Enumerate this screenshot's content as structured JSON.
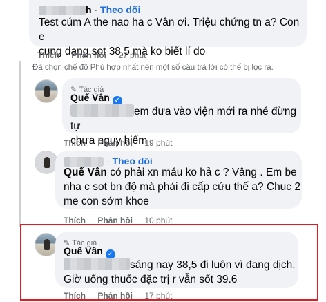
{
  "comment1": {
    "name_suffix": "h",
    "separator": "·",
    "follow": "Theo dõi",
    "text_line1": "Test cúm A the nao ha c Vân ơi. Triệu chứng tn a? Con e",
    "text_line2": "cung dang sot 38,5 mà ko biết lí do",
    "like": "Thích",
    "reply": "Phản hồi",
    "time": "27 phút"
  },
  "filter_notice": "Đã chọn chế độ Phù hợp nhất nên một số câu trả lời có thể bị lọc ra.",
  "reply1": {
    "author_tag": "Tác giả",
    "author": "Quế Vân",
    "text_line1": "em đưa vào viện mới ra nhé đừng tự",
    "text_line2": "chưa nguy hiểm",
    "like": "Thích",
    "reply": "Phản hồi",
    "time": "19 phút"
  },
  "reply2": {
    "separator": "·",
    "follow": "Theo dõi",
    "mention": "Quế Vân",
    "text_line1": " có phải xn máu ko hả c ? Vâng . Em be",
    "text_line2": "nha c sot bn độ mà phải đi cấp cứu thế a? Chuc 2",
    "text_line3": "me con sớm khoe",
    "like": "Thích",
    "reply": "Phản hồi",
    "time": "10 phút"
  },
  "reply3": {
    "author_tag": "Tác giả",
    "author": "Quế Vân",
    "text_line1": "sáng nay 38,5 đi luôn vì đang dịch.",
    "text_line2": "Giờ uống thuốc đặc trị r vẫn sốt 39.6",
    "like": "Thích",
    "reply": "Phản hồi",
    "time": "17 phút"
  },
  "colors": {
    "link": "#216fdb",
    "bubble": "#f0f2f5",
    "highlight": "#e01b24",
    "meta": "#65676b"
  }
}
